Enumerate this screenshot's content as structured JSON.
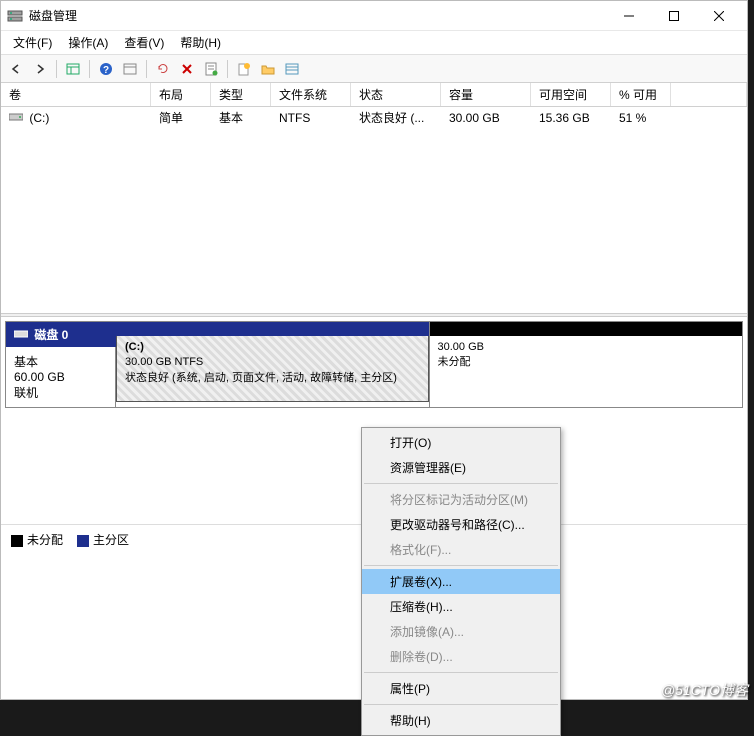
{
  "window": {
    "title": "磁盘管理"
  },
  "menubar": {
    "file": "文件(F)",
    "action": "操作(A)",
    "view": "查看(V)",
    "help": "帮助(H)"
  },
  "columns": {
    "volume": "卷",
    "layout": "布局",
    "type": "类型",
    "filesystem": "文件系统",
    "status": "状态",
    "capacity": "容量",
    "free": "可用空间",
    "pctfree": "% 可用"
  },
  "volumes": [
    {
      "name": "(C:)",
      "layout": "简单",
      "type": "基本",
      "filesystem": "NTFS",
      "status": "状态良好 (...",
      "capacity": "30.00 GB",
      "free": "15.36 GB",
      "pctfree": "51 %"
    }
  ],
  "disk": {
    "header": "磁盘 0",
    "type": "基本",
    "size": "60.00 GB",
    "state": "联机",
    "partitions": {
      "c": {
        "name": "(C:)",
        "size_fs": "30.00 GB NTFS",
        "status": "状态良好 (系统, 启动, 页面文件, 活动, 故障转储, 主分区)"
      },
      "u": {
        "size": "30.00 GB",
        "status": "未分配"
      }
    }
  },
  "legend": {
    "unallocated": "未分配",
    "primary": "主分区"
  },
  "context": {
    "open": "打开(O)",
    "explorer": "资源管理器(E)",
    "mark_active": "将分区标记为活动分区(M)",
    "change_letter": "更改驱动器号和路径(C)...",
    "format": "格式化(F)...",
    "extend": "扩展卷(X)...",
    "shrink": "压缩卷(H)...",
    "add_mirror": "添加镜像(A)...",
    "delete": "删除卷(D)...",
    "properties": "属性(P)",
    "help": "帮助(H)"
  },
  "watermark": "@51CTO博客"
}
